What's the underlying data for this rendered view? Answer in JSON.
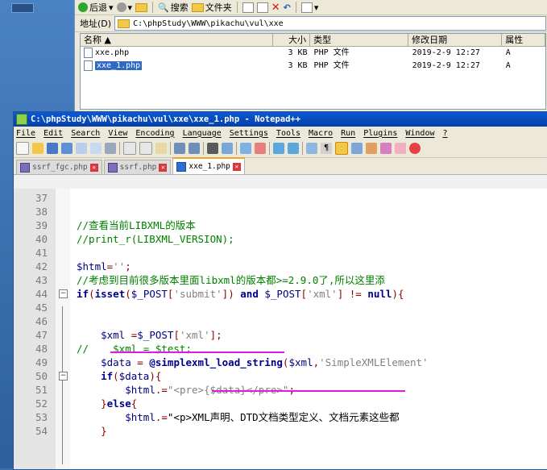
{
  "explorer": {
    "toolbar": {
      "back": "后退",
      "search": "搜索",
      "folders": "文件夹"
    },
    "address": {
      "label": "地址(D)",
      "path": "C:\\phpStudy\\WWW\\pikachu\\vul\\xxe"
    },
    "columns": {
      "name": "名称 ▲",
      "size": "大小",
      "type": "类型",
      "modified": "修改日期",
      "attributes": "属性"
    },
    "files": [
      {
        "name": "xxe.php",
        "size": "3 KB",
        "type": "PHP 文件",
        "modified": "2019-2-9 12:27",
        "attr": "A"
      },
      {
        "name": "xxe_1.php",
        "size": "3 KB",
        "type": "PHP 文件",
        "modified": "2019-2-9 12:27",
        "attr": "A"
      }
    ]
  },
  "notepad": {
    "title": "C:\\phpStudy\\WWW\\pikachu\\vul\\xxe\\xxe_1.php - Notepad++",
    "menu": [
      "File",
      "Edit",
      "Search",
      "View",
      "Encoding",
      "Language",
      "Settings",
      "Tools",
      "Macro",
      "Run",
      "Plugins",
      "Window",
      "?"
    ],
    "tabs": [
      "ssrf_fgc.php",
      "ssrf.php",
      "xxe_1.php"
    ],
    "active_tab": "xxe_1.php",
    "lines": [
      {
        "n": "37"
      },
      {
        "n": "38"
      },
      {
        "n": "39",
        "text": "//查看当前LIBXML的版本"
      },
      {
        "n": "40",
        "text": "//print_r(LIBXML_VERSION);"
      },
      {
        "n": "41"
      },
      {
        "n": "42",
        "text": "$html='';"
      },
      {
        "n": "43",
        "text": "//考虑到目前很多版本里面libxml的版本都>=2.9.0了,所以这里添"
      },
      {
        "n": "44",
        "text": "if(isset($_POST['submit']) and $_POST['xml'] != null){"
      },
      {
        "n": "45"
      },
      {
        "n": "46"
      },
      {
        "n": "47",
        "text": "    $xml =$_POST['xml'];"
      },
      {
        "n": "48",
        "text": "//    $xml = $test;"
      },
      {
        "n": "49",
        "text": "    $data = @simplexml_load_string($xml,'SimpleXMLElement'"
      },
      {
        "n": "50",
        "text": "    if($data){"
      },
      {
        "n": "51",
        "text": "        $html.=\"<pre>{$data}</pre>\";"
      },
      {
        "n": "52",
        "text": "    }else{"
      },
      {
        "n": "53",
        "text": "        $html.=\"<p>XML声明、DTD文档类型定义、文档元素这些都"
      },
      {
        "n": "54",
        "text": "    }"
      }
    ]
  },
  "colors": {
    "annotation": "#e01ae0",
    "title_bar": "#0a58d5",
    "comment": "#008000",
    "keyword": "#00008b"
  }
}
